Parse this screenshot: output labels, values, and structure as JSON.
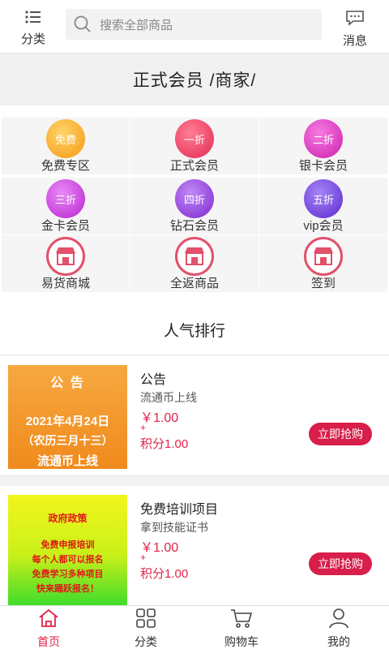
{
  "topbar": {
    "category_label": "分类",
    "search_placeholder": "搜索全部商品",
    "message_label": "消息"
  },
  "banner": {
    "title": "正式会员 /商家/"
  },
  "grid": [
    {
      "badge": "免费",
      "label": "免费专区",
      "color": "#f7a21b"
    },
    {
      "badge": "一折",
      "label": "正式会员",
      "color": "#e8345a"
    },
    {
      "badge": "二折",
      "label": "银卡会员",
      "color": "#d62ab8"
    },
    {
      "badge": "三折",
      "label": "金卡会员",
      "color": "#c42fd4"
    },
    {
      "badge": "四折",
      "label": "钻石会员",
      "color": "#8a2cd8"
    },
    {
      "badge": "五折",
      "label": "vip会员",
      "color": "#6a2ad6"
    },
    {
      "badge": "",
      "label": "易货商城",
      "icon": "shop-icon"
    },
    {
      "badge": "",
      "label": "全返商品",
      "icon": "shop-icon"
    },
    {
      "badge": "",
      "label": "签到",
      "icon": "shop-icon"
    }
  ],
  "section_title": "人气排行",
  "products": [
    {
      "name": "公告",
      "subtitle": "流通币上线",
      "price": "￥1.00",
      "plus": "+",
      "points": "积分1.00",
      "buy_label": "立即抢购",
      "thumb_lines": [
        "公 告",
        "2021年4月24日",
        "（农历三月十三）",
        "流通币上线"
      ]
    },
    {
      "name": "免费培训项目",
      "subtitle": "拿到技能证书",
      "price": "￥1.00",
      "plus": "+",
      "points": "积分1.00",
      "buy_label": "立即抢购",
      "thumb_lines": [
        "政府政策",
        "免费申报培训",
        "每个人都可以报名",
        "免费学习多种项目",
        "快来踊跃报名！"
      ]
    }
  ],
  "bottom_nav": [
    {
      "label": "首页",
      "icon": "home-icon",
      "active": true
    },
    {
      "label": "分类",
      "icon": "grid-icon",
      "active": false
    },
    {
      "label": "购物车",
      "icon": "cart-icon",
      "active": false
    },
    {
      "label": "我的",
      "icon": "user-icon",
      "active": false
    }
  ],
  "colors": {
    "accent": "#e0244a",
    "buy_button": "#d81e4a"
  }
}
